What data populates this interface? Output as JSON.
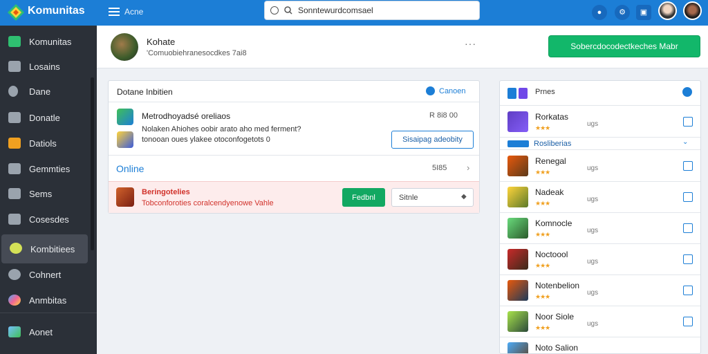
{
  "topbar": {
    "title": "Komunitas",
    "menu_label": "Acne",
    "search_value": "Sonntewurdcomsael",
    "colors": {
      "bar": "#1c7ed6"
    }
  },
  "sidebar": {
    "items": [
      {
        "label": "Komunitas",
        "icon": "leaf-icon"
      },
      {
        "label": "Losains",
        "icon": "car-icon"
      },
      {
        "label": "Dane",
        "icon": "user-icon"
      },
      {
        "label": "Donatle",
        "icon": "document-icon"
      },
      {
        "label": "Datiols",
        "icon": "cube-icon"
      },
      {
        "label": "Gemmties",
        "icon": "wrench-icon"
      },
      {
        "label": "Sems",
        "icon": "list-icon"
      },
      {
        "label": "Cosesdes",
        "icon": "chat-icon"
      },
      {
        "label": "Kombitiees",
        "icon": "community-icon"
      },
      {
        "label": "Cohnert",
        "icon": "circle-icon"
      },
      {
        "label": "Anmbitas",
        "icon": "globe-icon"
      },
      {
        "label": "Aonet",
        "icon": "photo-icon"
      }
    ],
    "active_index": 8
  },
  "profile": {
    "name": "Kohate",
    "subtitle": "'Comuobiehranesocdkes 7ai8",
    "dots": "···",
    "cta_label": "Sobercdocodectkeches Mabr"
  },
  "panel": {
    "title": "Dotane Inbitien",
    "link": "Canoen",
    "row1": {
      "title": "Metrodhoyadsé oreliaos",
      "meta": "R 8i8 00",
      "desc_line1": "Nolaken Ahiohes oobir arato aho med ferment?",
      "desc_line2": "tonooan oues ylakee otoconfogetots 0",
      "button": "Sisaipag adeobity"
    },
    "row2": {
      "label": "Online",
      "count": "5I85"
    },
    "row3": {
      "title": "Beringotelies",
      "subtitle": "Tobconforoties coralcendyenowe Vahle",
      "button": "Fedbnl",
      "select_value": "Sitnle"
    }
  },
  "right": {
    "header": "Prnes",
    "section": "Rosliberias",
    "items": [
      {
        "name": "Rorkatas",
        "meta": "ugs"
      },
      {
        "name": "Renegal",
        "meta": "ugs"
      },
      {
        "name": "Nadeak",
        "meta": "ugs"
      },
      {
        "name": "Komnocle",
        "meta": "ugs"
      },
      {
        "name": "Noctoool",
        "meta": "ugs"
      },
      {
        "name": "Notenbelion",
        "meta": "ugs"
      },
      {
        "name": "Noor Siole",
        "meta": "ugs"
      },
      {
        "name": "Noto Salion",
        "meta": ""
      }
    ],
    "stars": "★★★"
  }
}
